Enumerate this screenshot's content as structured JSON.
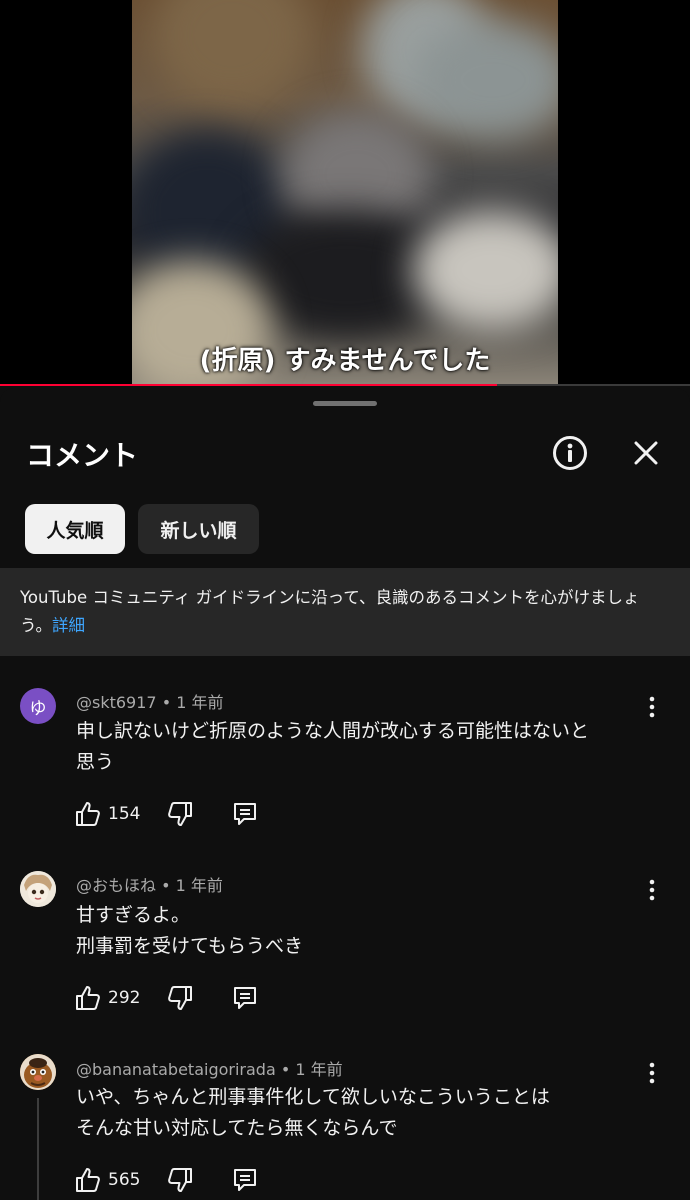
{
  "video": {
    "subtitle": "(折原) すみませんでした",
    "progress_fraction": 0.72
  },
  "panel": {
    "title": "コメント",
    "info_icon": "info-icon",
    "close_icon": "close-icon"
  },
  "sort": {
    "popular": "人気順",
    "newest": "新しい順"
  },
  "guidelines": {
    "text": "YouTube コミュニティ ガイドラインに沿って、良識のあるコメントを心がけましょう。",
    "link": "詳細"
  },
  "comments": [
    {
      "author": "@skt6917",
      "time": "1 年前",
      "avatar_letter": "ゆ",
      "lines": [
        "申し訳ないけど折原のような人間が改心する可能性はないと",
        "思う"
      ],
      "likes": "154"
    },
    {
      "author": "@おもほね",
      "time": "1 年前",
      "lines": [
        "甘すぎるよ。",
        "刑事罰を受けてもらうべき"
      ],
      "likes": "292"
    },
    {
      "author": "@bananatabetaigorirada",
      "time": "1 年前",
      "lines": [
        "いや、ちゃんと刑事事件化して欲しいなこういうことは",
        "そんな甘い対応してたら無くならんで"
      ],
      "likes": "565"
    }
  ],
  "colors": {
    "background": "#0f0f0f",
    "accent_red": "#ff0033",
    "link_blue": "#3ea6ff",
    "chip_bg": "#272727"
  }
}
